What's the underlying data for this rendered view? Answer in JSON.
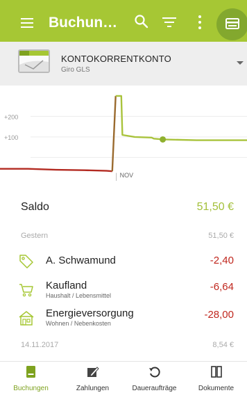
{
  "appbar": {
    "title": "Buchun…",
    "menu_icon": "menu-icon",
    "search_icon": "search-icon",
    "filter_icon": "filter-icon",
    "more_icon": "more-vert-icon",
    "fab_icon": "card-icon"
  },
  "account": {
    "name": "KONTOKORRENTKONTO",
    "bank": "Giro GLS"
  },
  "chart_data": {
    "type": "line",
    "y_tick_labels": [
      "+200",
      "+100"
    ],
    "x_tick_labels": [
      "NOV"
    ],
    "segments": [
      {
        "color": "#b32a21",
        "points": [
          [
            0,
            -55
          ],
          [
            25,
            -55
          ],
          [
            50,
            -60
          ],
          [
            75,
            -62
          ],
          [
            95,
            -65
          ],
          [
            100,
            -67
          ]
        ]
      },
      {
        "color": "#9a6a2e",
        "points": [
          [
            100,
            -67
          ],
          [
            103,
            300
          ]
        ]
      },
      {
        "color": "#a9c33c",
        "points": [
          [
            103,
            300
          ],
          [
            108,
            300
          ],
          [
            109,
            110
          ],
          [
            120,
            100
          ],
          [
            135,
            97
          ],
          [
            137,
            92
          ],
          [
            145,
            88
          ],
          [
            175,
            84
          ],
          [
            220,
            84
          ]
        ]
      }
    ],
    "x_range": [
      0,
      220
    ],
    "y_range": [
      -90,
      330
    ],
    "marker": {
      "x": 145,
      "y": 88,
      "color": "#8fb02e"
    }
  },
  "colors": {
    "brand": "#a6c734",
    "positive": "#a3c03a",
    "negative": "#c0271e",
    "active_nav": "#7ea21f"
  },
  "saldo": {
    "label": "Saldo",
    "value": "51,50 €"
  },
  "days": [
    {
      "label": "Gestern",
      "amount": "51,50 €"
    },
    {
      "label": "14.11.2017",
      "amount": "8,54 €"
    }
  ],
  "transactions": [
    {
      "title": "A. Schwamund",
      "subtitle": "",
      "amount": "-2,40",
      "icon": "tag-icon"
    },
    {
      "title": "Kaufland",
      "subtitle": "Haushalt / Lebensmittel",
      "amount": "-6,64",
      "icon": "cart-icon"
    },
    {
      "title": "Energieversorgung",
      "subtitle": "Wohnen / Nebenkosten",
      "amount": "-28,00",
      "icon": "house-icon"
    }
  ],
  "nav": [
    {
      "label": "Buchungen",
      "icon": "bookings-icon",
      "active": true
    },
    {
      "label": "Zahlungen",
      "icon": "payments-icon",
      "active": false
    },
    {
      "label": "Daueraufträge",
      "icon": "standing-orders-icon",
      "active": false
    },
    {
      "label": "Dokumente",
      "icon": "documents-icon",
      "active": false
    }
  ]
}
